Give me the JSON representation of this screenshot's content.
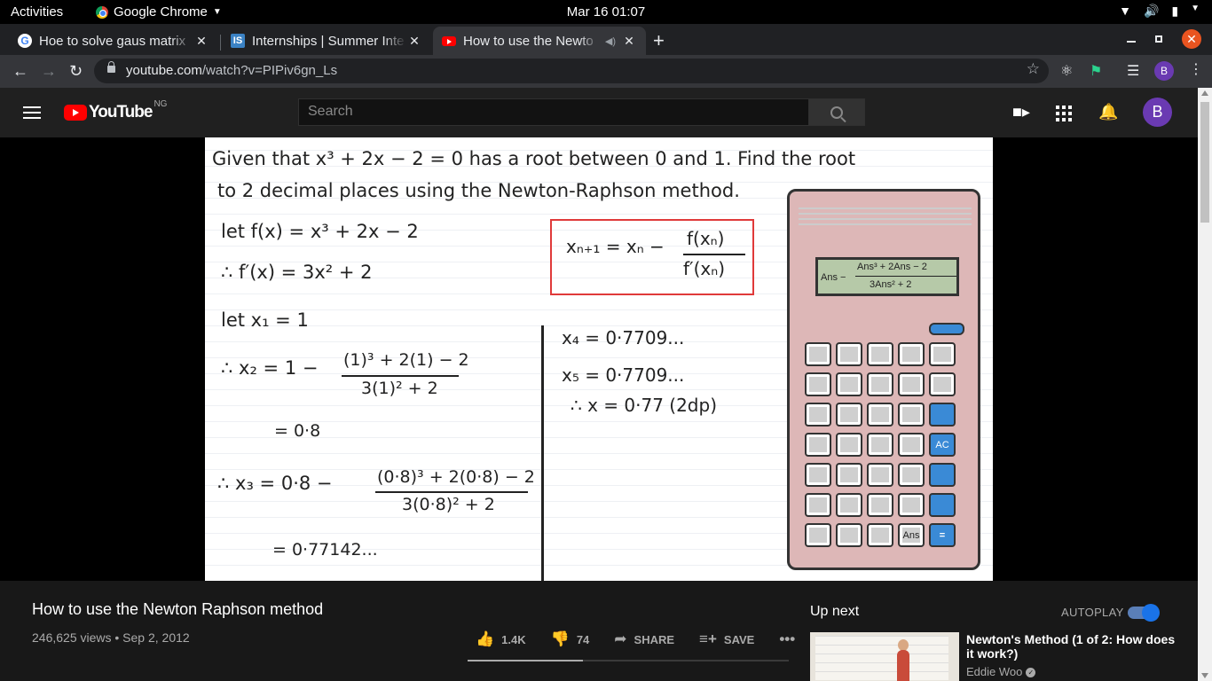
{
  "system": {
    "activities": "Activities",
    "app_name": "Google Chrome",
    "clock": "Mar 16  01:07"
  },
  "tabs": [
    {
      "title": "Hoe to solve gaus matrix",
      "favicon": "google-icon"
    },
    {
      "title": "Internships | Summer Inte",
      "favicon": "internshala-icon"
    },
    {
      "title": "How to use the Newto",
      "favicon": "youtube-icon",
      "active": true
    }
  ],
  "omnibox": {
    "host": "youtube.com",
    "path": "/watch?v=PIPiv6gn_Ls",
    "profile_letter": "B"
  },
  "youtube": {
    "logo_text": "YouTube",
    "country_code": "NG",
    "search_placeholder": "Search",
    "avatar_letter": "B"
  },
  "video": {
    "line1": "Given that  x³ + 2x − 2 = 0  has a root between 0 and 1. Find the root",
    "line2": "to 2 decimal places using the Newton-Raphson method.",
    "let_f": "let  f(x) = x³ + 2x − 2",
    "deriv": "∴  f′(x) = 3x² + 2",
    "let_x1": "let  x₁ = 1",
    "x2_lhs": "∴  x₂ =  1 −",
    "x2_num": "(1)³ + 2(1) − 2",
    "x2_den": "3(1)² + 2",
    "x2_val": "= 0·8",
    "x3_lhs": "∴ x₃ =  0·8 −",
    "x3_num": "(0·8)³ + 2(0·8) − 2",
    "x3_den": "3(0·8)² + 2",
    "x3_val": "= 0·77142...",
    "formula_lhs": "xₙ₊₁ = xₙ −",
    "formula_num": "f(xₙ)",
    "formula_den": "f′(xₙ)",
    "x4": "x₄ = 0·7709...",
    "x5": "x₅ = 0·7709...",
    "answer": "∴  x = 0·77 (2dp)",
    "calc_screen_left": "Ans −",
    "calc_screen_num": "Ans³ + 2Ans − 2",
    "calc_screen_den": "3Ans² + 2",
    "calc_ac": "AC",
    "calc_ans": "Ans",
    "calc_eq": "="
  },
  "info": {
    "title": "How to use the Newton Raphson method",
    "meta": "246,625 views • Sep 2, 2012",
    "likes": "1.4K",
    "dislikes": "74",
    "share": "SHARE",
    "save": "SAVE",
    "like_ratio": 0.36
  },
  "sidebar": {
    "up_next": "Up next",
    "autoplay": "AUTOPLAY",
    "autoplay_on": true,
    "rec_title": "Newton's Method (1 of 2: How does it work?)",
    "rec_channel": "Eddie Woo"
  },
  "colors": {
    "yt_red": "#ff0000",
    "accent_blue": "#3ea6ff",
    "formula_box": "#e03a3a",
    "calc_body": "#ddb7b7"
  }
}
